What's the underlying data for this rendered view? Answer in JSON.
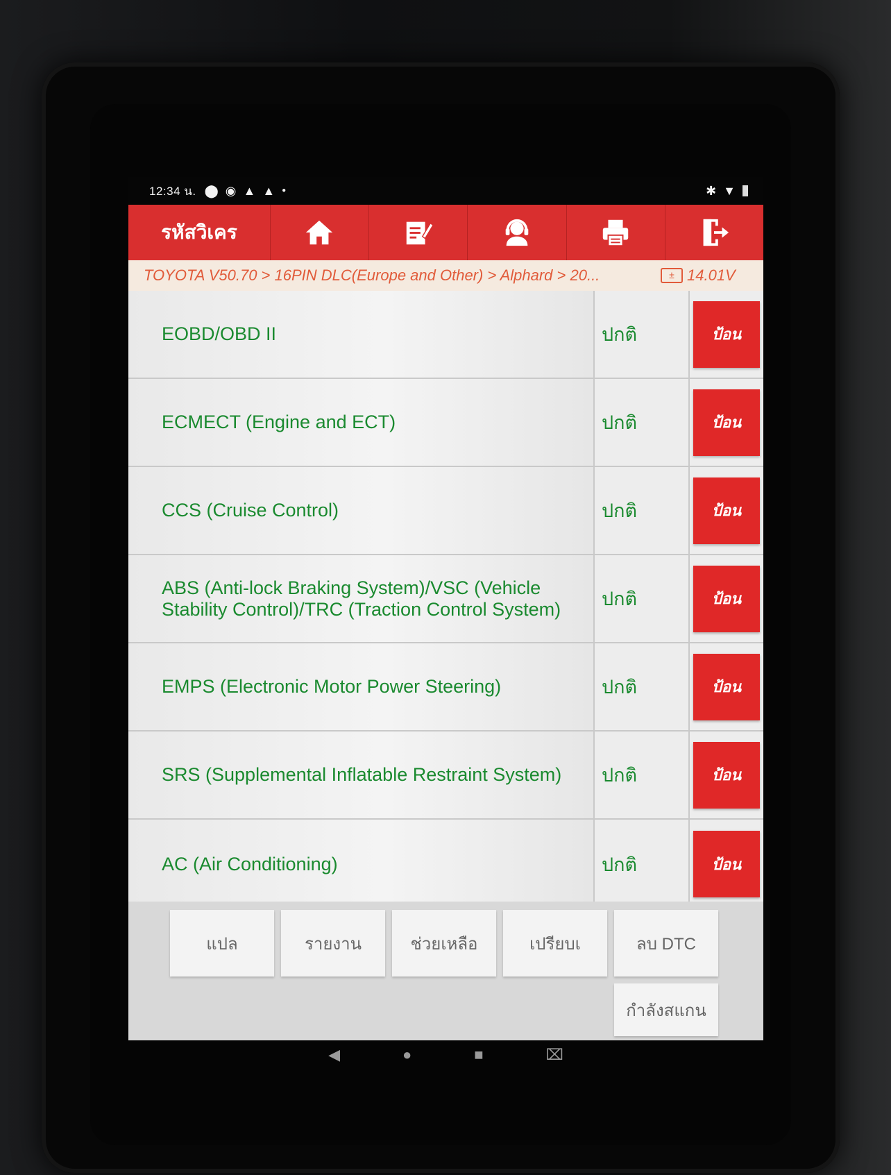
{
  "status_bar": {
    "time": "12:34 น.",
    "left_icons": [
      "alert-circle-icon",
      "nfc-icon",
      "warning-icon",
      "warning-icon",
      "dot-icon"
    ],
    "right_icons": [
      "bluetooth-icon",
      "wifi-icon",
      "battery-icon"
    ]
  },
  "toolbar": {
    "title": "รหัสวิเคร",
    "buttons": [
      "home-icon",
      "edit-icon",
      "support-icon",
      "print-icon",
      "exit-icon"
    ]
  },
  "breadcrumb": {
    "path": "TOYOTA V50.70 > 16PIN DLC(Europe and Other) > Alphard > 20...",
    "voltage": "14.01V"
  },
  "systems": [
    {
      "name": "EOBD/OBD II",
      "status": "ปกติ",
      "action": "ป้อน"
    },
    {
      "name": "ECMECT (Engine and ECT)",
      "status": "ปกติ",
      "action": "ป้อน"
    },
    {
      "name": "CCS (Cruise Control)",
      "status": "ปกติ",
      "action": "ป้อน"
    },
    {
      "name": "ABS (Anti-lock Braking System)/VSC (Vehicle Stability Control)/TRC (Traction Control System)",
      "status": "ปกติ",
      "action": "ป้อน"
    },
    {
      "name": "EMPS (Electronic Motor Power Steering)",
      "status": "ปกติ",
      "action": "ป้อน"
    },
    {
      "name": "SRS (Supplemental Inflatable Restraint System)",
      "status": "ปกติ",
      "action": "ป้อน"
    },
    {
      "name": "AC (Air Conditioning)",
      "status": "ปกติ",
      "action": "ป้อน"
    }
  ],
  "bottom_buttons": {
    "translate": "แปล",
    "report": "รายงาน",
    "help": "ช่วยเหลือ",
    "compare": "เปรียบเ",
    "clear_dtc": "ลบ DTC",
    "scanning": "กำลังสแกน"
  },
  "nav": [
    "back-icon",
    "home-circle-icon",
    "recents-icon",
    "screenshot-icon"
  ]
}
